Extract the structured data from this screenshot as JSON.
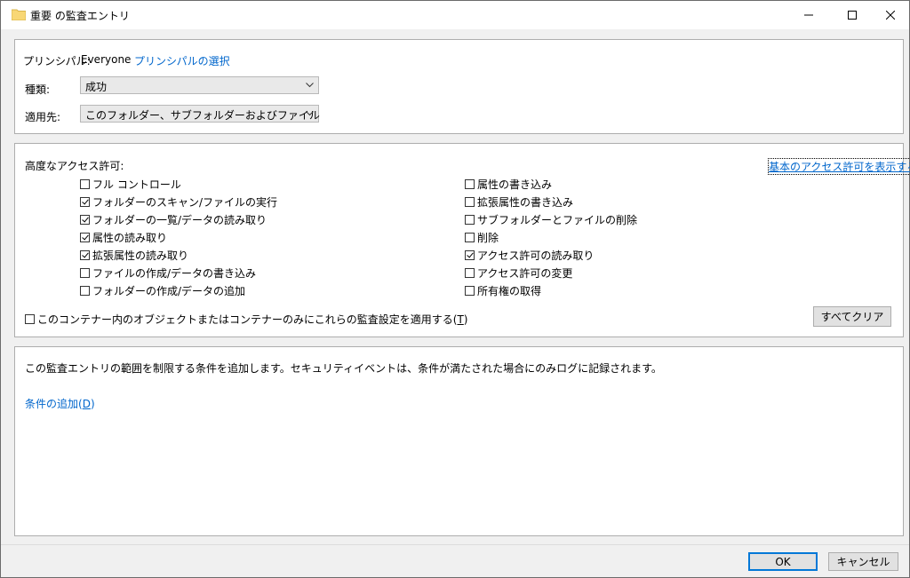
{
  "window": {
    "title": "重要 の監査エントリ",
    "folder_color": "#f8d775"
  },
  "principal": {
    "label": "プリンシパル:",
    "value": "Everyone",
    "select_link": "プリンシパルの選択"
  },
  "type": {
    "label": "種類:",
    "value": "成功"
  },
  "applies_to": {
    "label": "適用先:",
    "value": "このフォルダー、サブフォルダーおよびファイル"
  },
  "advanced": {
    "heading": "高度なアクセス許可:",
    "show_basic_link": "基本のアクセス許可を表示する",
    "left": [
      {
        "label": "フル コントロール",
        "checked": false
      },
      {
        "label": "フォルダーのスキャン/ファイルの実行",
        "checked": true
      },
      {
        "label": "フォルダーの一覧/データの読み取り",
        "checked": true
      },
      {
        "label": "属性の読み取り",
        "checked": true
      },
      {
        "label": "拡張属性の読み取り",
        "checked": true
      },
      {
        "label": "ファイルの作成/データの書き込み",
        "checked": false
      },
      {
        "label": "フォルダーの作成/データの追加",
        "checked": false
      }
    ],
    "right": [
      {
        "label": "属性の書き込み",
        "checked": false
      },
      {
        "label": "拡張属性の書き込み",
        "checked": false
      },
      {
        "label": "サブフォルダーとファイルの削除",
        "checked": false
      },
      {
        "label": "削除",
        "checked": false
      },
      {
        "label": "アクセス許可の読み取り",
        "checked": true
      },
      {
        "label": "アクセス許可の変更",
        "checked": false
      },
      {
        "label": "所有権の取得",
        "checked": false
      }
    ],
    "container_only_label": "このコンテナー内のオブジェクトまたはコンテナーのみにこれらの監査設定を適用する(",
    "container_only_key": "T",
    "container_only_end": ")",
    "container_only_checked": false,
    "clear_all_button": "すべてクリア"
  },
  "conditions": {
    "description": "この監査エントリの範囲を制限する条件を追加します。セキュリティイベントは、条件が満たされた場合にのみログに記録されます。",
    "add_link": "条件の追加(",
    "add_key": "D",
    "add_end": ")"
  },
  "footer": {
    "ok": "OK",
    "cancel": "キャンセル"
  }
}
